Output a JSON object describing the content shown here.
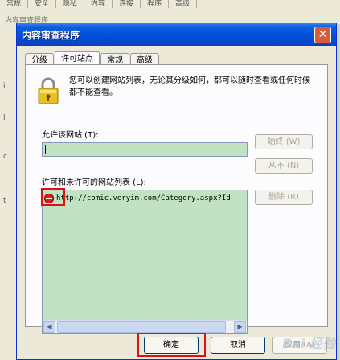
{
  "background": {
    "tabs": [
      "常规",
      "安全",
      "隐私",
      "内容",
      "连接",
      "程序",
      "高级"
    ],
    "subtitle": "内容审查程序",
    "marks": [
      "i",
      "l",
      "c",
      "t"
    ]
  },
  "dialog": {
    "title": "内容审查程序",
    "close_glyph": "✕",
    "tabs": [
      {
        "label": "分级",
        "active": false
      },
      {
        "label": "许可站点",
        "active": true
      },
      {
        "label": "常规",
        "active": false
      },
      {
        "label": "高级",
        "active": false
      }
    ],
    "description": "您可以创建网站列表，无论其分级如何，都可以随时查看或任何时候都不能查看。",
    "allow_site_label": "允许该网站 (T):",
    "site_input_value": "",
    "always_button": "始终 (W)",
    "never_button": "从不 (N)",
    "list_label": "许可和未许可的网站列表 (L):",
    "remove_button": "删除 (R)",
    "sites": [
      {
        "url": "http://comic.veryim.com/Category.aspx?Id",
        "status": "blocked"
      }
    ],
    "ok_button": "确定",
    "cancel_button": "取消",
    "apply_button": "应用 (A)"
  },
  "watermark": "Bai 经验",
  "colors": {
    "titlebar": "#0351d8",
    "list_bg": "#c2e3c3",
    "highlight": "#e01010"
  }
}
